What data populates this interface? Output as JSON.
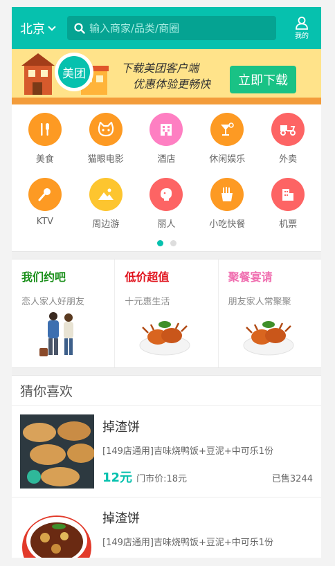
{
  "header": {
    "city": "北京",
    "search_placeholder": "输入商家/品类/商圈",
    "user_label": "我的"
  },
  "banner": {
    "logo_text": "美团",
    "line1": "下载美团客户端",
    "line2": "优惠体验更畅快",
    "download_label": "立即下载"
  },
  "categories": [
    {
      "label": "美食",
      "icon": "fork-knife-icon",
      "color": "#fd9a23"
    },
    {
      "label": "猫眼电影",
      "icon": "cat-face-icon",
      "color": "#fd9a23"
    },
    {
      "label": "酒店",
      "icon": "hotel-building-icon",
      "color": "#fe7fc2"
    },
    {
      "label": "休闲娱乐",
      "icon": "cocktail-icon",
      "color": "#fd9a23"
    },
    {
      "label": "外卖",
      "icon": "scooter-icon",
      "color": "#fd6464"
    },
    {
      "label": "KTV",
      "icon": "microphone-icon",
      "color": "#fd9a23"
    },
    {
      "label": "周边游",
      "icon": "mountain-photo-icon",
      "color": "#fdc52f"
    },
    {
      "label": "丽人",
      "icon": "woman-profile-icon",
      "color": "#fd6464"
    },
    {
      "label": "小吃快餐",
      "icon": "fries-icon",
      "color": "#fd9a23"
    },
    {
      "label": "机票",
      "icon": "building-icon",
      "color": "#fd6464"
    }
  ],
  "pager": {
    "count": 2,
    "active": 0
  },
  "promos": [
    {
      "title": "我们约吧",
      "subtitle": "恋人家人好朋友",
      "color": "#1a8f1a"
    },
    {
      "title": "低价超值",
      "subtitle": "十元惠生活",
      "color": "#e0111b"
    },
    {
      "title": "聚餐宴请",
      "subtitle": "朋友家人常聚聚",
      "color": "#f06fb0"
    }
  ],
  "guess": {
    "title": "猜你喜欢",
    "items": [
      {
        "name": "掉渣饼",
        "desc": "[149店通用]吉味烧鸭饭+豆泥+中可乐1份",
        "price": "12元",
        "orig": "门市价:18元",
        "sold": "已售3244"
      },
      {
        "name": "掉渣饼",
        "desc": "[149店通用]吉味烧鸭饭+豆泥+中可乐1份",
        "price": "",
        "orig": "",
        "sold": ""
      }
    ]
  }
}
